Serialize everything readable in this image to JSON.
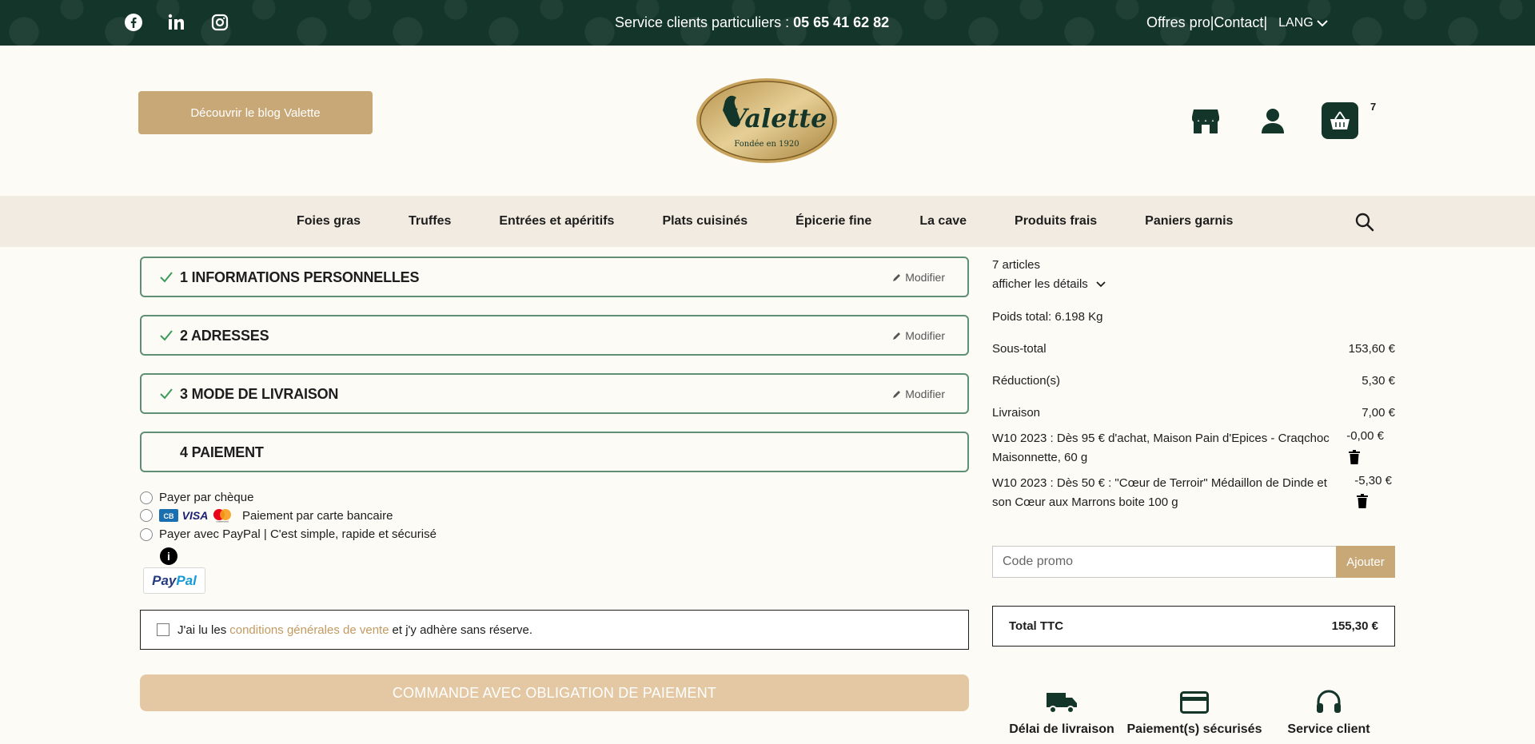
{
  "topbar": {
    "service_label": "Service clients particuliers : ",
    "service_phone": "05 65 41 62 82",
    "offres_pro": "Offres pro",
    "sep1": " | ",
    "contact": "Contact",
    "sep2": " |",
    "lang": "LANG"
  },
  "header": {
    "blog_button": "Découvrir le blog Valette",
    "logo_name": "Valette",
    "logo_tagline": "Fondée en 1920",
    "cart_count": "7"
  },
  "nav": {
    "items": [
      "Foies gras",
      "Truffes",
      "Entrées et apéritifs",
      "Plats cuisinés",
      "Épicerie fine",
      "La cave",
      "Produits frais",
      "Paniers garnis"
    ]
  },
  "steps": [
    {
      "title": "1 INFORMATIONS PERSONNELLES",
      "modify": "Modifier"
    },
    {
      "title": "2 ADRESSES",
      "modify": "Modifier"
    },
    {
      "title": "3 MODE DE LIVRAISON",
      "modify": "Modifier"
    },
    {
      "title": "4 PAIEMENT"
    }
  ],
  "payment": {
    "cheque": "Payer par chèque",
    "card": "Paiement par carte bancaire",
    "paypal": "Payer avec PayPal | C'est simple, rapide et sécurisé",
    "paypal_logo_1": "Pay",
    "paypal_logo_2": "Pal",
    "card_logos": [
      "CB",
      "VISA",
      "mastercard"
    ]
  },
  "cgv": {
    "before": "J'ai lu les",
    "link": "conditions générales de vente",
    "after": "et j'y adhère sans réserve."
  },
  "order_button": "COMMANDE AVEC OBLIGATION DE PAIEMENT",
  "summary": {
    "articles": "7 articles",
    "details": "afficher les détails",
    "weight": "Poids total: 6.198 Kg",
    "subtotal_label": "Sous-total",
    "subtotal_value": "153,60 €",
    "reduction_label": "Réduction(s)",
    "reduction_value": "5,30 €",
    "shipping_label": "Livraison",
    "shipping_value": "7,00 €",
    "discounts": [
      {
        "text": "W10 2023 : Dès 95 € d'achat, Maison Pain d'Epices - Craqchoc Maisonnette, 60 g",
        "value": "-0,00 €"
      },
      {
        "text": "W10 2023 : Dès 50 € : \"Cœur de Terroir\" Médaillon de Dinde et son Cœur aux Marrons boite 100 g",
        "value": "-5,30 €"
      }
    ],
    "promo_placeholder": "Code promo",
    "promo_button": "Ajouter",
    "total_label": "Total TTC",
    "total_value": "155,30 €"
  },
  "reassurance": [
    "Délai de livraison",
    "Paiement(s) sécurisés",
    "Service client"
  ],
  "colors": {
    "dark_green": "#14362a",
    "gold": "#c9a877",
    "step_border": "#5f8f75",
    "nav_bg": "#f2ebe1"
  }
}
